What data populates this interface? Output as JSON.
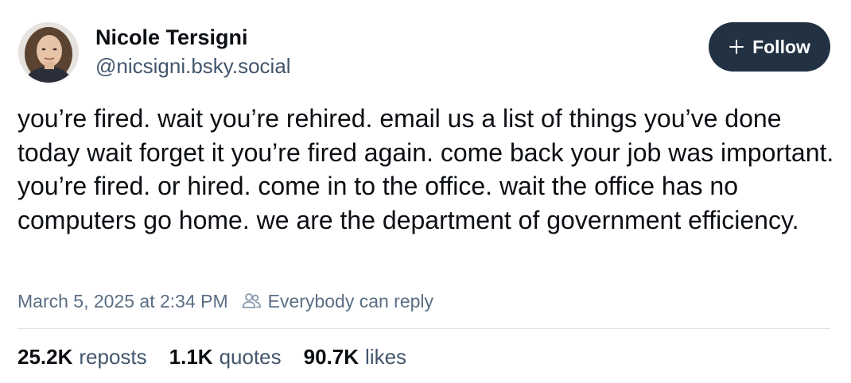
{
  "author": {
    "name": "Nicole Tersigni",
    "handle": "@nicsigni.bsky.social",
    "avatar_icon": "profile-photo"
  },
  "follow_button": {
    "icon": "plus-icon",
    "label": "Follow"
  },
  "post": {
    "text": "you’re fired. wait you’re rehired. email us a list of things you’ve done today wait forget it you’re fired again. come back your job was important. you’re fired. or hired. come in to the office. wait the office has no computers go home. we are the department of government efficiency."
  },
  "meta": {
    "timestamp": "March 5, 2025 at 2:34 PM",
    "reply_icon": "people-icon",
    "reply_setting": "Everybody can reply"
  },
  "stats": {
    "reposts": {
      "count": "25.2K",
      "label": "reposts"
    },
    "quotes": {
      "count": "1.1K",
      "label": "quotes"
    },
    "likes": {
      "count": "90.7K",
      "label": "likes"
    }
  },
  "colors": {
    "follow_button_bg": "#223243",
    "secondary_text": "#42566c",
    "divider": "#dfe4ea"
  }
}
